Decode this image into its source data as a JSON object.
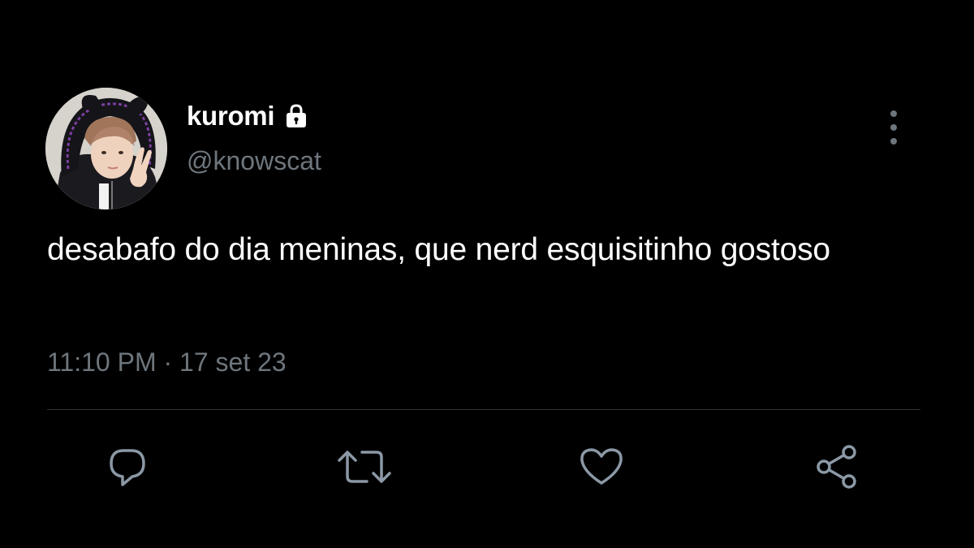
{
  "user": {
    "display_name": "kuromi",
    "handle": "@knowscat",
    "protected": true
  },
  "tweet": {
    "text": "desabafo do dia meninas, que nerd esquisitinho gostoso",
    "timestamp": "11:10 PM · 17 set 23"
  },
  "icons": {
    "lock": "lock-icon",
    "more": "more-vertical-icon",
    "reply": "reply-icon",
    "retweet": "retweet-icon",
    "like": "heart-icon",
    "share": "share-icon"
  },
  "colors": {
    "background": "#000000",
    "text_primary": "#ffffff",
    "text_secondary": "#6e767d",
    "divider": "#2f3336",
    "icon": "#8b98a5"
  }
}
